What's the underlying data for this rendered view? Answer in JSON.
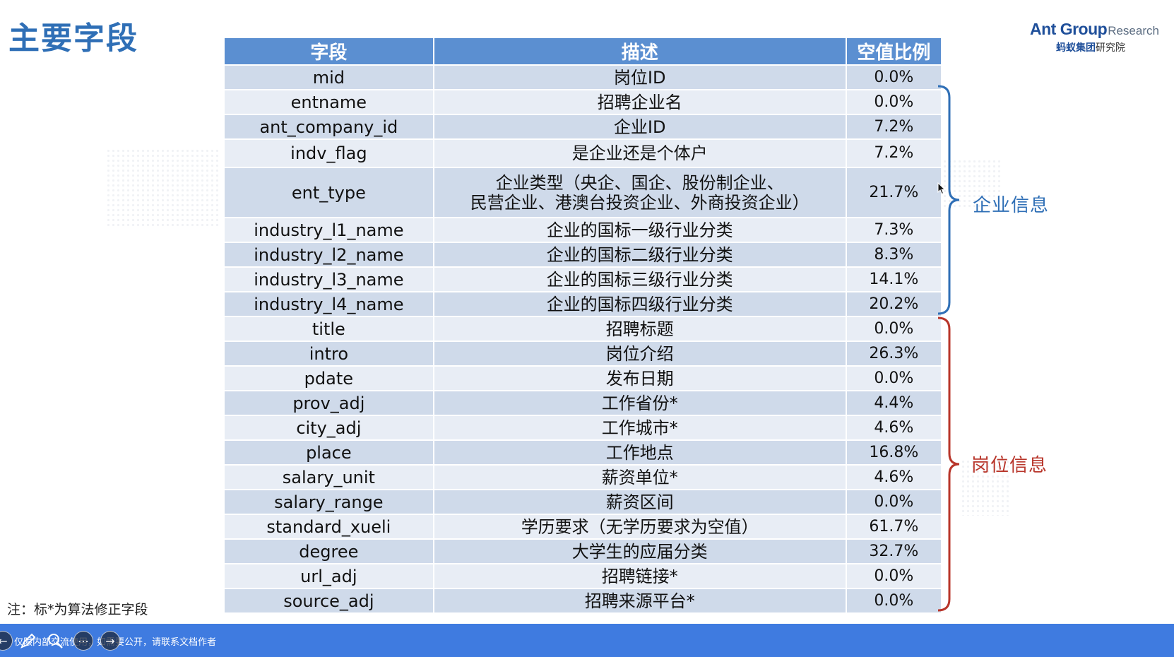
{
  "page": {
    "title": "主要字段",
    "footnote": "注：标*为算法修正字段"
  },
  "logo": {
    "brand": "Ant Group",
    "suffix": "Research",
    "cn_brand": "蚂蚁集团",
    "cn_suffix": "研究院"
  },
  "table": {
    "headers": [
      "字段",
      "描述",
      "空值比例"
    ],
    "rows": [
      {
        "field": "mid",
        "desc": "岗位ID",
        "null_ratio": "0.0%"
      },
      {
        "field": "entname",
        "desc": "招聘企业名",
        "null_ratio": "0.0%"
      },
      {
        "field": "ant_company_id",
        "desc": "企业ID",
        "null_ratio": "7.2%"
      },
      {
        "field": "indv_flag",
        "desc": "是企业还是个体户",
        "null_ratio": "7.2%"
      },
      {
        "field": "ent_type",
        "desc": "企业类型（央企、国企、股份制企业、",
        "desc2": "民营企业、港澳台投资企业、外商投资企业）",
        "null_ratio": "21.7%"
      },
      {
        "field": "industry_l1_name",
        "desc": "企业的国标一级行业分类",
        "null_ratio": "7.3%"
      },
      {
        "field": "industry_l2_name",
        "desc": "企业的国标二级行业分类",
        "null_ratio": "8.3%"
      },
      {
        "field": "industry_l3_name",
        "desc": "企业的国标三级行业分类",
        "null_ratio": "14.1%"
      },
      {
        "field": "industry_l4_name",
        "desc": "企业的国标四级行业分类",
        "null_ratio": "20.2%"
      },
      {
        "field": "title",
        "desc": "招聘标题",
        "null_ratio": "0.0%"
      },
      {
        "field": "intro",
        "desc": "岗位介绍",
        "null_ratio": "26.3%"
      },
      {
        "field": "pdate",
        "desc": "发布日期",
        "null_ratio": "0.0%"
      },
      {
        "field": "prov_adj",
        "desc": "工作省份*",
        "null_ratio": "4.4%"
      },
      {
        "field": "city_adj",
        "desc": "工作城市*",
        "null_ratio": "4.6%"
      },
      {
        "field": "place",
        "desc": "工作地点",
        "null_ratio": "16.8%"
      },
      {
        "field": "salary_unit",
        "desc": "薪资单位*",
        "null_ratio": "4.6%"
      },
      {
        "field": "salary_range",
        "desc": "薪资区间",
        "null_ratio": "0.0%"
      },
      {
        "field": "standard_xueli",
        "desc": "学历要求（无学历要求为空值）",
        "null_ratio": "61.7%"
      },
      {
        "field": "degree",
        "desc": "大学生的应届分类",
        "null_ratio": "32.7%"
      },
      {
        "field": "url_adj",
        "desc": "招聘链接*",
        "null_ratio": "0.0%"
      },
      {
        "field": "source_adj",
        "desc": "招聘来源平台*",
        "null_ratio": "0.0%"
      }
    ]
  },
  "groups": {
    "company": {
      "label": "企业信息",
      "color": "#2f6fb6"
    },
    "position": {
      "label": "岗位信息",
      "color": "#b8352a"
    }
  },
  "bottom_bar": {
    "notice": "仅限内部交流使用，如需要公开，请联系文档作者",
    "color": "#3f7be0",
    "controls": [
      "prev-icon",
      "pen-icon",
      "zoom-icon",
      "more-icon",
      "next-icon"
    ]
  },
  "colors": {
    "title": "#2f6fb6",
    "header_bg": "#5b8fd1",
    "row_dark": "#cfdaea",
    "row_light": "#e8edf5"
  }
}
